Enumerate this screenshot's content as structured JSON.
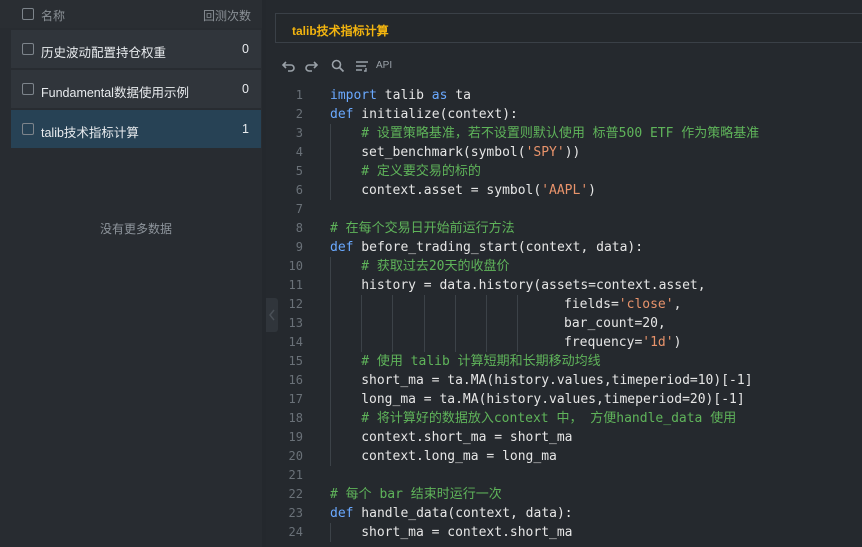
{
  "strategy_list": {
    "header": {
      "name_label": "名称",
      "count_label": "回测次数"
    },
    "rows": [
      {
        "name": "历史波动配置持仓权重",
        "count": "0"
      },
      {
        "name": "Fundamental数据使用示例",
        "count": "0"
      },
      {
        "name": "talib技术指标计算",
        "count": "1"
      }
    ],
    "empty_text": "没有更多数据"
  },
  "editor": {
    "tab_title": "talib技术指标计算",
    "toolbar": {
      "api_label": "API"
    },
    "lines": [
      {
        "n": "1",
        "indent": 0,
        "tokens": [
          [
            "kw",
            "import"
          ],
          [
            "p",
            " talib "
          ],
          [
            "kw",
            "as"
          ],
          [
            "p",
            " ta"
          ]
        ]
      },
      {
        "n": "2",
        "indent": 0,
        "tokens": [
          [
            "kw",
            "def"
          ],
          [
            "p",
            " initialize(context):"
          ]
        ]
      },
      {
        "n": "3",
        "indent": 1,
        "tokens": [
          [
            "cm",
            "# 设置策略基准，若不设置则默认使用 标普500 ETF 作为策略基准"
          ]
        ]
      },
      {
        "n": "4",
        "indent": 1,
        "tokens": [
          [
            "p",
            "set_benchmark(symbol("
          ],
          [
            "str",
            "'SPY'"
          ],
          [
            "p",
            "))"
          ]
        ]
      },
      {
        "n": "5",
        "indent": 1,
        "tokens": [
          [
            "cm",
            "# 定义要交易的标的"
          ]
        ]
      },
      {
        "n": "6",
        "indent": 1,
        "tokens": [
          [
            "p",
            "context.asset = symbol("
          ],
          [
            "str",
            "'AAPL'"
          ],
          [
            "p",
            ")"
          ]
        ]
      },
      {
        "n": "7",
        "indent": 0,
        "tokens": []
      },
      {
        "n": "8",
        "indent": 0,
        "tokens": [
          [
            "cm",
            "# 在每个交易日开始前运行方法"
          ]
        ]
      },
      {
        "n": "9",
        "indent": 0,
        "tokens": [
          [
            "kw",
            "def"
          ],
          [
            "p",
            " before_trading_start(context, data):"
          ]
        ]
      },
      {
        "n": "10",
        "indent": 1,
        "tokens": [
          [
            "cm",
            "# 获取过去20天的收盘价"
          ]
        ]
      },
      {
        "n": "11",
        "indent": 1,
        "tokens": [
          [
            "p",
            "history = data.history(assets=context.asset,"
          ]
        ]
      },
      {
        "n": "12",
        "indent": 7,
        "pad": 2,
        "tokens": [
          [
            "p",
            "fields="
          ],
          [
            "str",
            "'close'"
          ],
          [
            "p",
            ","
          ]
        ]
      },
      {
        "n": "13",
        "indent": 7,
        "pad": 2,
        "tokens": [
          [
            "p",
            "bar_count=20,"
          ]
        ]
      },
      {
        "n": "14",
        "indent": 7,
        "pad": 2,
        "tokens": [
          [
            "p",
            "frequency="
          ],
          [
            "str",
            "'1d'"
          ],
          [
            "p",
            ")"
          ]
        ]
      },
      {
        "n": "15",
        "indent": 1,
        "tokens": [
          [
            "cm",
            "# 使用 talib 计算短期和长期移动均线"
          ]
        ]
      },
      {
        "n": "16",
        "indent": 1,
        "tokens": [
          [
            "p",
            "short_ma = ta.MA(history.values,timeperiod=10)[-1]"
          ]
        ]
      },
      {
        "n": "17",
        "indent": 1,
        "tokens": [
          [
            "p",
            "long_ma = ta.MA(history.values,timeperiod=20)[-1]"
          ]
        ]
      },
      {
        "n": "18",
        "indent": 1,
        "tokens": [
          [
            "cm",
            "# 将计算好的数据放入context 中， 方便handle_data 使用"
          ]
        ]
      },
      {
        "n": "19",
        "indent": 1,
        "tokens": [
          [
            "p",
            "context.short_ma = short_ma"
          ]
        ]
      },
      {
        "n": "20",
        "indent": 1,
        "tokens": [
          [
            "p",
            "context.long_ma = long_ma"
          ]
        ]
      },
      {
        "n": "21",
        "indent": 0,
        "tokens": []
      },
      {
        "n": "22",
        "indent": 0,
        "tokens": [
          [
            "cm",
            "# 每个 bar 结束时运行一次"
          ]
        ]
      },
      {
        "n": "23",
        "indent": 0,
        "tokens": [
          [
            "kw",
            "def"
          ],
          [
            "p",
            " handle_data(context, data):"
          ]
        ]
      },
      {
        "n": "24",
        "indent": 1,
        "tokens": [
          [
            "p",
            "short_ma = context.short_ma"
          ]
        ]
      }
    ]
  }
}
